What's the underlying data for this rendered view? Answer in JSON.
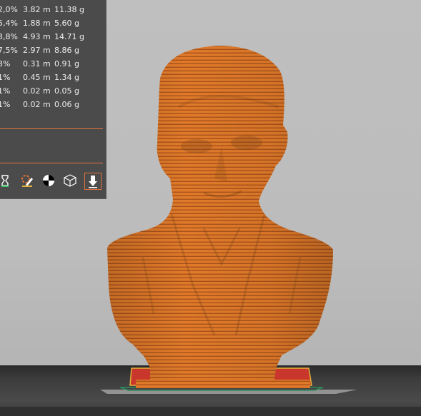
{
  "filament_stats": [
    {
      "percent": "2,0%",
      "length": "3.82 m",
      "weight": "11.38 g"
    },
    {
      "percent": "5,4%",
      "length": "1.88 m",
      "weight": "5.60 g"
    },
    {
      "percent": "3,8%",
      "length": "4.93 m",
      "weight": "14.71 g"
    },
    {
      "percent": "7,5%",
      "length": "2.97 m",
      "weight": "8.86 g"
    },
    {
      "percent": "3%",
      "length": "0.31 m",
      "weight": "0.91 g"
    },
    {
      "percent": "1%",
      "length": "0.45 m",
      "weight": "1.34 g"
    },
    {
      "percent": "1%",
      "length": "0.02 m",
      "weight": "0.05 g"
    },
    {
      "percent": "1%",
      "length": "0.02 m",
      "weight": "0.06 g"
    }
  ],
  "toolbar": {
    "icons": [
      "hourglass-icon",
      "paint-brush-icon",
      "center-of-gravity-icon",
      "wireframe-cube-icon",
      "export-down-icon"
    ]
  },
  "colors": {
    "panel_bg": "#4b4b4b",
    "accent": "#e3733a",
    "model_orange": "#e07a2a",
    "viewport_bg": "#bcbcbc",
    "bed_red": "#c9372c",
    "bed_outline": "#2d8a5a"
  }
}
